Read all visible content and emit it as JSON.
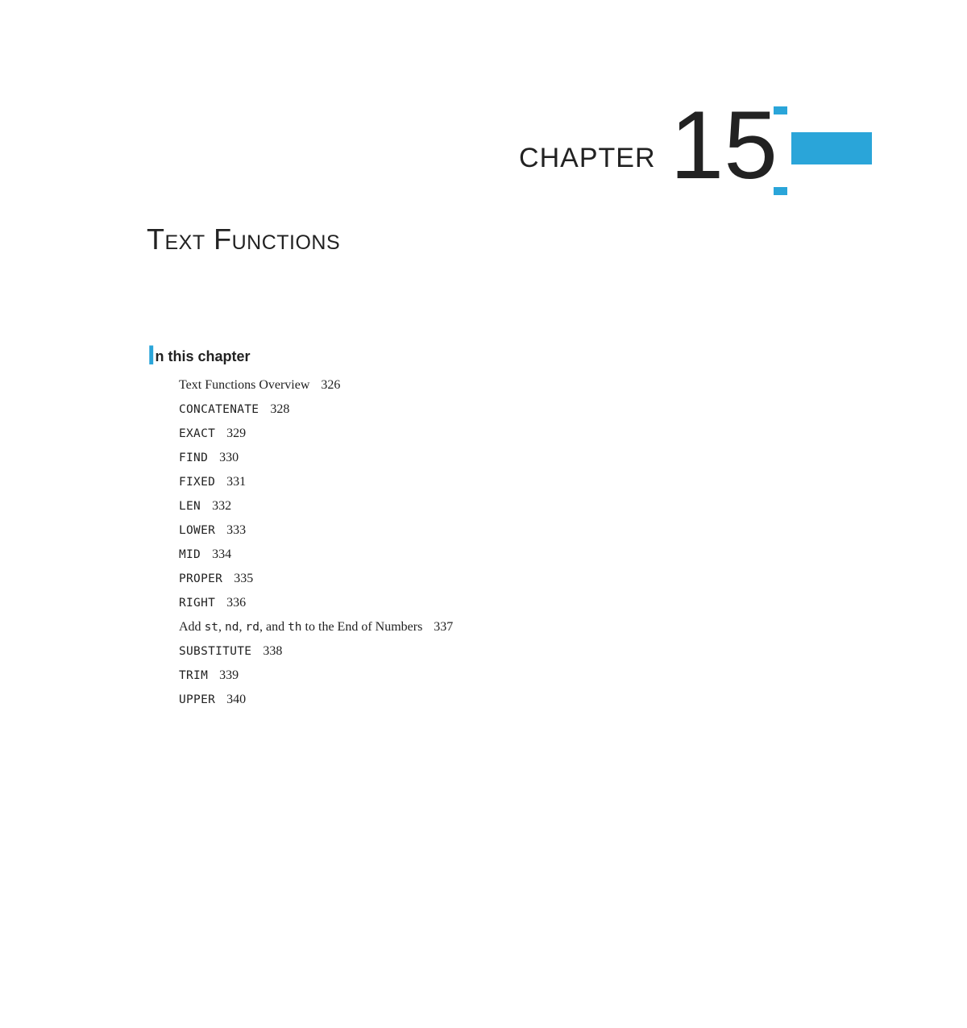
{
  "chapter": {
    "label": "CHAPTER",
    "number": "15",
    "title": "Text Functions"
  },
  "in_this_chapter": {
    "big_letter": "I",
    "rest": "n this chapter"
  },
  "toc": [
    {
      "type": "serif",
      "label": "Text Functions Overview",
      "page": "326"
    },
    {
      "type": "code",
      "label": "CONCATENATE",
      "page": "328"
    },
    {
      "type": "code",
      "label": "EXACT",
      "page": "329"
    },
    {
      "type": "code",
      "label": "FIND",
      "page": "330"
    },
    {
      "type": "code",
      "label": "FIXED",
      "page": "331"
    },
    {
      "type": "code",
      "label": "LEN",
      "page": "332"
    },
    {
      "type": "code",
      "label": "LOWER",
      "page": "333"
    },
    {
      "type": "code",
      "label": "MID",
      "page": "334"
    },
    {
      "type": "code",
      "label": "PROPER",
      "page": "335"
    },
    {
      "type": "code",
      "label": "RIGHT",
      "page": "336"
    },
    {
      "type": "mixed",
      "parts": [
        {
          "t": "serif",
          "v": "Add "
        },
        {
          "t": "mono",
          "v": "st"
        },
        {
          "t": "serif",
          "v": ", "
        },
        {
          "t": "mono",
          "v": "nd"
        },
        {
          "t": "serif",
          "v": ", "
        },
        {
          "t": "mono",
          "v": "rd"
        },
        {
          "t": "serif",
          "v": ", and "
        },
        {
          "t": "mono",
          "v": "th"
        },
        {
          "t": "serif",
          "v": " to the End of Numbers"
        }
      ],
      "page": "337"
    },
    {
      "type": "code",
      "label": "SUBSTITUTE",
      "page": "338"
    },
    {
      "type": "code",
      "label": "TRIM",
      "page": "339"
    },
    {
      "type": "code",
      "label": "UPPER",
      "page": "340"
    }
  ]
}
